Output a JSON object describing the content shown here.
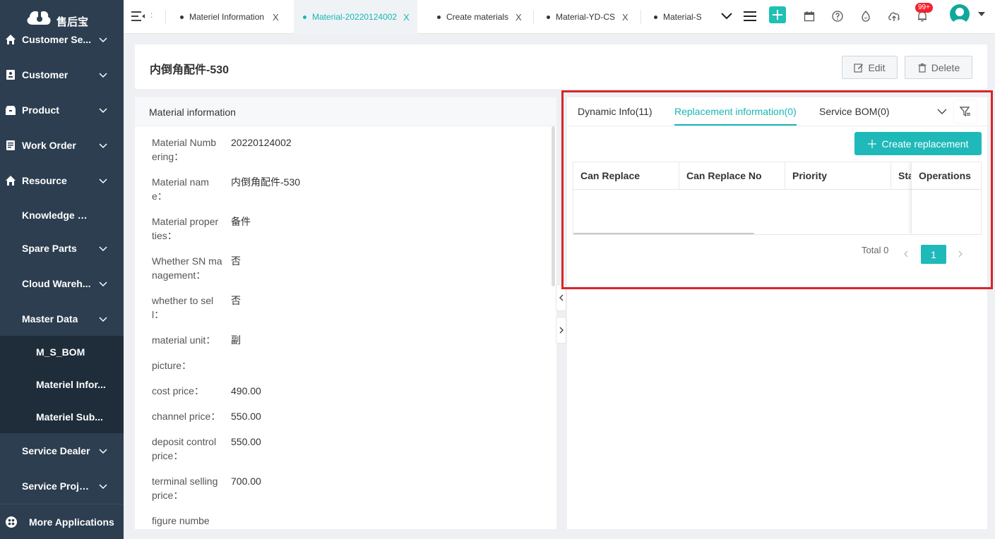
{
  "app": {
    "logo_text": "售后宝"
  },
  "sidebar": {
    "items": [
      {
        "label": "Customer Se...",
        "icon": "home-icon"
      },
      {
        "label": "Customer",
        "icon": "contact-icon"
      },
      {
        "label": "Product",
        "icon": "box-icon"
      },
      {
        "label": "Work Order",
        "icon": "order-icon"
      },
      {
        "label": "Resource",
        "icon": "home-icon"
      },
      {
        "label": "Knowledge B..."
      },
      {
        "label": "Spare Parts"
      },
      {
        "label": "Cloud Wareh..."
      },
      {
        "label": "Master Data"
      },
      {
        "label": "M_S_BOM"
      },
      {
        "label": "Materiel Infor..."
      },
      {
        "label": "Materiel Sub..."
      },
      {
        "label": "Service Dealer"
      },
      {
        "label": "Service Project"
      }
    ],
    "more_apps": "More Applications"
  },
  "topbar": {
    "dots": ":",
    "tabs": [
      {
        "label": "Materiel Information",
        "close": "X"
      },
      {
        "label": "Material-20220124002",
        "close": "X",
        "active": true
      },
      {
        "label": "Create materials",
        "close": "X"
      },
      {
        "label": "Material-YD-CS",
        "close": "X"
      },
      {
        "label": "Material-S"
      }
    ],
    "notification_badge": "99+"
  },
  "header": {
    "title": "内倒角配件-530",
    "edit_label": "Edit",
    "delete_label": "Delete"
  },
  "material_info": {
    "title": "Material information",
    "fields": [
      {
        "key": "Material Numb\nering：",
        "value": "20220124002"
      },
      {
        "key": "Material nam\ne：",
        "value": "内倒角配件-530"
      },
      {
        "key": "Material proper\nties：",
        "value": "备件"
      },
      {
        "key": "Whether SN ma\nnagement：",
        "value": "否"
      },
      {
        "key": "whether to sel\nl：",
        "value": "否"
      },
      {
        "key": "material unit：",
        "value": "副"
      },
      {
        "key": "picture：",
        "value": ""
      },
      {
        "key": "cost price：",
        "value": "490.00"
      },
      {
        "key": "channel price：",
        "value": "550.00"
      },
      {
        "key": "deposit control\nprice：",
        "value": "550.00"
      },
      {
        "key": "terminal selling\nprice：",
        "value": "700.00"
      },
      {
        "key": "figure numbe",
        "value": ""
      }
    ]
  },
  "right_panel": {
    "tabs": [
      {
        "label": "Dynamic Info(11)"
      },
      {
        "label": "Replacement information(0)",
        "active": true
      },
      {
        "label": "Service BOM(0)"
      }
    ],
    "create_button": "Create replacement",
    "table": {
      "columns": [
        "Can Replace",
        "Can Replace No",
        "Priority",
        "Sta",
        "Operations"
      ],
      "rows": []
    },
    "pagination": {
      "total": "Total 0",
      "current_page": "1"
    }
  },
  "colors": {
    "accent": "#1fb9b9",
    "sidebar_bg": "#2c3e50",
    "highlight": "#d7262a"
  }
}
